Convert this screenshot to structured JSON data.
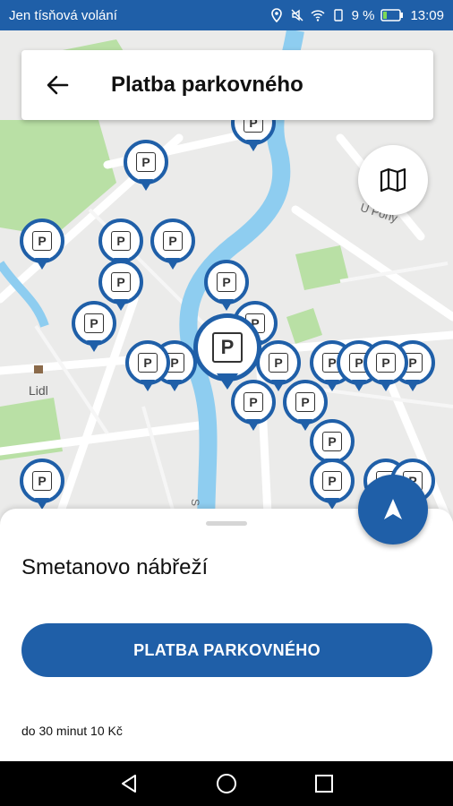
{
  "status_bar": {
    "carrier": "Jen tísňová volání",
    "battery": "9 %",
    "time": "13:09"
  },
  "header": {
    "title": "Platba parkovného",
    "back_icon": "arrow-left-icon"
  },
  "map": {
    "labels": {
      "shop": "Lidl",
      "street_a": "U Pony",
      "street_b": "S"
    },
    "pin_label": "P",
    "map_button_icon": "map-icon",
    "nav_button_icon": "navigation-arrow-icon"
  },
  "sheet": {
    "place_name": "Smetanovo nábřeží",
    "pay_button": "PLATBA PARKOVNÉHO",
    "tariff": "do 30 minut 10 Kč"
  },
  "nav_bar": {
    "back": "triangle-back-icon",
    "home": "circle-home-icon",
    "recents": "square-recents-icon"
  },
  "colors": {
    "brand": "#1f5fa8",
    "river": "#8ecdf0",
    "park": "#b9e0a5"
  }
}
